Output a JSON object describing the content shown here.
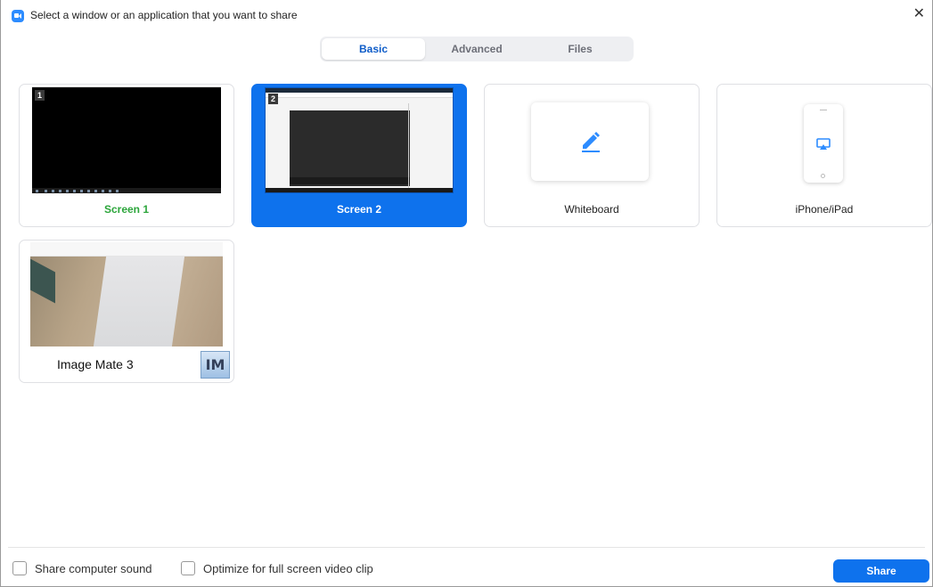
{
  "window": {
    "title": "Select a window or an application that you want to share",
    "close_glyph": "✕"
  },
  "tabs": [
    {
      "label": "Basic",
      "active": true
    },
    {
      "label": "Advanced",
      "active": false
    },
    {
      "label": "Files",
      "active": false
    }
  ],
  "cards": [
    {
      "label": "Screen 1",
      "badge": "1",
      "selected": false,
      "label_color": "#2ca53b"
    },
    {
      "label": "Screen 2",
      "badge": "2",
      "selected": true
    },
    {
      "label": "Whiteboard",
      "icon": "pencil-icon"
    },
    {
      "label": "iPhone/iPad",
      "icon": "airplay-icon"
    },
    {
      "label": "Image Mate 3",
      "app_icon_text": "IM"
    }
  ],
  "footer": {
    "share_sound_label": "Share computer sound",
    "optimize_label": "Optimize for full screen video clip",
    "share_button": "Share"
  },
  "colors": {
    "accent": "#0e72ed",
    "selected_tab_text": "#0e5cc8",
    "screen1_label": "#2ca53b"
  }
}
